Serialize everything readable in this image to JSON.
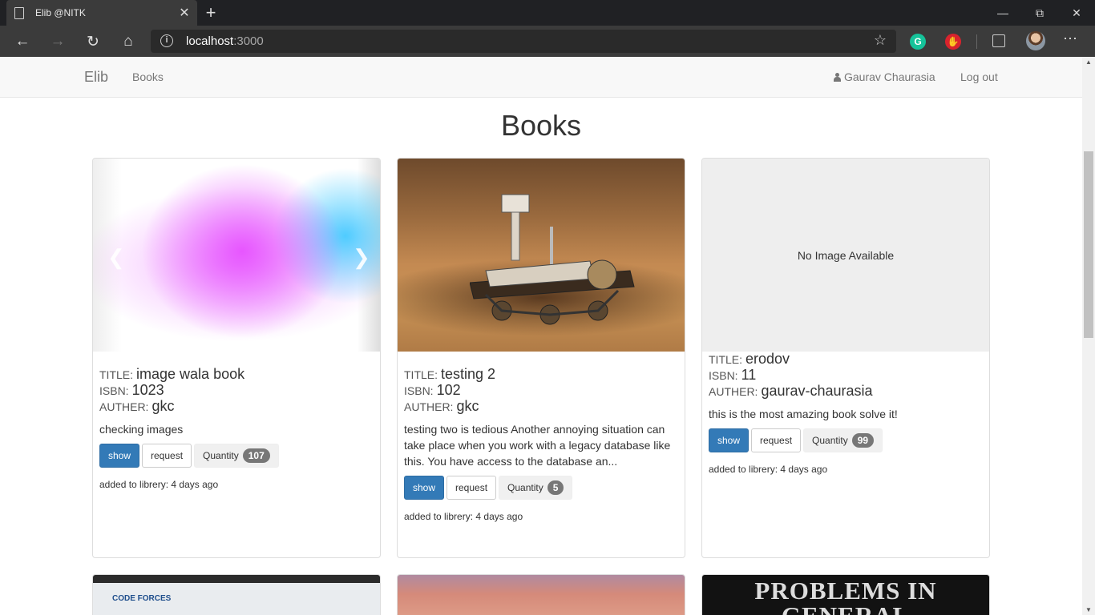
{
  "browser": {
    "tab_title": "Elib @NITK",
    "tab_close": "✕",
    "new_tab": "+",
    "url_host": "localhost",
    "url_port": ":3000",
    "ext_grammarly": "G",
    "icons": {
      "back": "back-arrow-icon",
      "forward": "forward-arrow-icon",
      "refresh": "refresh-icon",
      "home": "home-icon",
      "info": "info-icon",
      "favorite": "star-icon",
      "more": "more-icon"
    }
  },
  "navbar": {
    "brand": "Elib",
    "books_link": "Books",
    "user_name": "Gaurav Chaurasia",
    "logout": "Log out"
  },
  "page": {
    "title": "Books"
  },
  "labels": {
    "title": "TITLE:",
    "isbn": "ISBN:",
    "auther": "AUTHER:",
    "show": "show",
    "request": "request",
    "quantity": "Quantity",
    "added_prefix": "added to librery:"
  },
  "books": [
    {
      "title": "image wala book",
      "isbn": "1023",
      "auther": "gkc",
      "description": "checking images",
      "quantity": "107",
      "added": "4 days ago"
    },
    {
      "title": "testing 2",
      "isbn": "102",
      "auther": "gkc",
      "description": "testing two is tedious Another annoying situation can take place when you work with a legacy database like this. You have access to the database an...",
      "quantity": "5",
      "added": "4 days ago"
    },
    {
      "title": "erodov",
      "isbn": "11",
      "auther": "gaurav-chaurasia",
      "description": "this is the most amazing book solve it!",
      "quantity": "99",
      "added": "4 days ago",
      "image_placeholder": "No Image Available"
    }
  ],
  "next_row": {
    "cover_3_text_line1": "PROBLEMS IN",
    "cover_3_text_line2": "GENERAL",
    "cover_1_logo": "CODE FORCES"
  },
  "colors": {
    "primary": "#337ab7",
    "badge": "#777777",
    "navbar_bg": "#f8f8f8"
  }
}
